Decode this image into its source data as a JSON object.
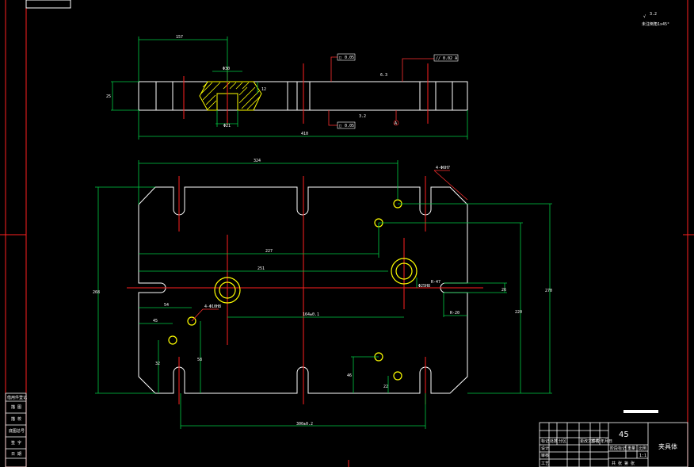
{
  "drawing": {
    "roughness_label": "3.2",
    "chamfer_note": "未注倒角1x45°",
    "material": "45",
    "part_name": "夹具体"
  },
  "front_view": {
    "dims": {
      "top_left": "157",
      "counterbore_top": "Φ30",
      "counterbore_depth": "12",
      "thickness": "25",
      "counterbore_bottom": "Φ21",
      "overall_length": "410"
    },
    "tolerances": {
      "flatness_top": "0.05",
      "parallel": "// 0.02 A",
      "flatness_bottom": "0.05",
      "surf_top": "6.3",
      "surf_bottom": "3.2",
      "datum": "A"
    }
  },
  "plan_view": {
    "dims": {
      "top_width": "324",
      "hole_top_right": "4-Φ6H7",
      "height_left": "268",
      "dim_227": "227",
      "dim_251": "251",
      "slot_radius": "R-47",
      "slot_vert": "Φ25H8",
      "center_dist": "164±0.1",
      "dim_54": "54",
      "hole_left": "4-Φ10H8",
      "dim_45": "45",
      "dim_32": "32",
      "dim_58": "58",
      "slot_width": "26",
      "dim_R20": "R-20",
      "dim_220": "220",
      "dim_270": "270",
      "dim_46": "46",
      "dim_22": "22",
      "bottom_width": "300±0.2"
    }
  },
  "title_block": {
    "left_rows": [
      "借用件登记",
      "描 图",
      "描 校",
      "底图总号",
      "签 字",
      "日 期"
    ],
    "grid_labels": [
      "标记",
      "处数",
      "分区",
      "更改文件号",
      "签名",
      "年月日"
    ],
    "row_labels": [
      "设计",
      "审核",
      "工艺"
    ],
    "stage_labels": [
      "阶段标记",
      "重量",
      "比例"
    ],
    "scale": "1:1",
    "sheet": "共 张 第 张"
  }
}
